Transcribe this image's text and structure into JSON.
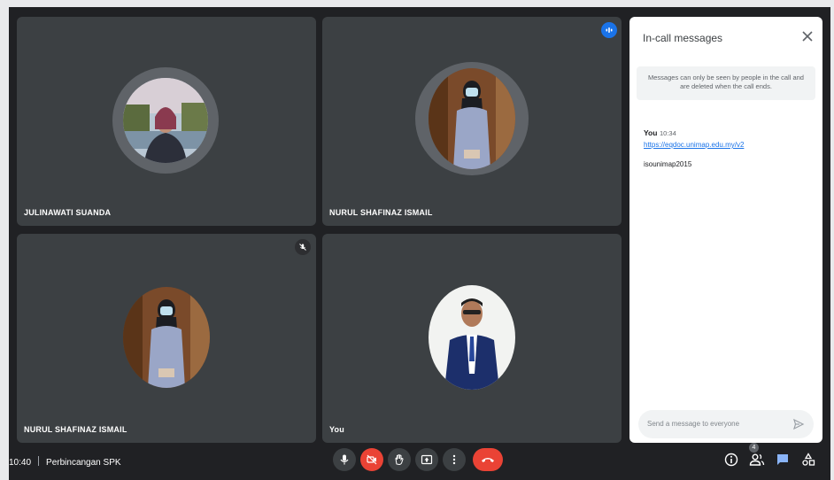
{
  "participants": [
    {
      "name": "JULINAWATI SUANDA"
    },
    {
      "name": "NURUL SHAFINAZ ISMAIL"
    },
    {
      "name": "NURUL SHAFINAZ ISMAIL"
    },
    {
      "name": "You"
    }
  ],
  "chat": {
    "title": "In-call messages",
    "notice": "Messages can only be seen by people in the call and are deleted when the call ends.",
    "message": {
      "sender": "You",
      "time": "10:34",
      "link": "https://eqdoc.unimap.edu.my/v2",
      "text": "isounimap2015"
    },
    "input_placeholder": "Send a message to everyone"
  },
  "meeting": {
    "time": "10:40",
    "title": "Perbincangan SPK"
  },
  "people_count": "4",
  "colors": {
    "accent": "#1a73e8",
    "danger": "#ea4335",
    "tile": "#3c4043",
    "bar": "#202124"
  },
  "icons": [
    "microphone-icon",
    "camera-off-icon",
    "raise-hand-icon",
    "present-icon",
    "more-options-icon",
    "end-call-icon",
    "info-icon",
    "people-icon",
    "chat-icon",
    "activities-icon",
    "close-icon",
    "send-icon",
    "mic-muted-icon",
    "speaking-indicator-icon"
  ]
}
